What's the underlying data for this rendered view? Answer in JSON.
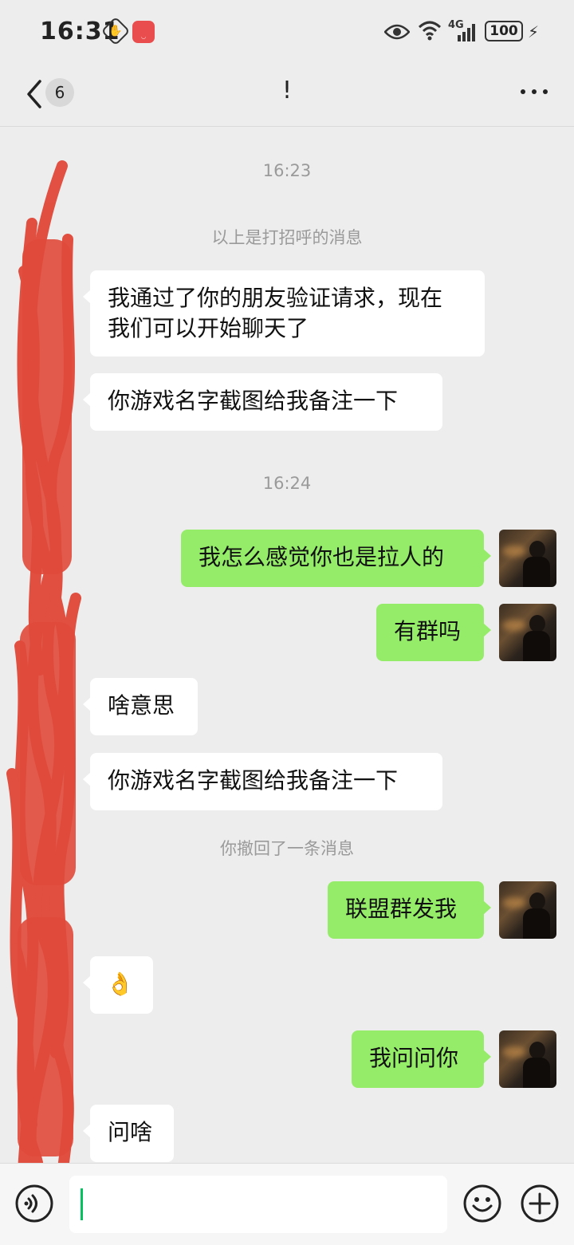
{
  "status_bar": {
    "time": "16:31",
    "network": "4G",
    "battery": "100",
    "icons": [
      "hand-icon",
      "huawei-app-icon",
      "eye-icon",
      "wifi-icon",
      "signal-icon",
      "battery-icon",
      "charging-bolt-icon"
    ]
  },
  "header": {
    "back_badge": "6",
    "title": "!",
    "more_icon": "more-icon"
  },
  "messages": [
    {
      "type": "system",
      "text": "16:23"
    },
    {
      "type": "system",
      "text": "以上是打招呼的消息"
    },
    {
      "type": "in",
      "lines": [
        "我通过了你的朋友验证请求，现在",
        "我们可以开始聊天了"
      ]
    },
    {
      "type": "in",
      "text": "你游戏名字截图给我备注一下"
    },
    {
      "type": "system",
      "text": "16:24"
    },
    {
      "type": "out",
      "text": "我怎么感觉你也是拉人的"
    },
    {
      "type": "out",
      "text": "有群吗"
    },
    {
      "type": "in",
      "text": "啥意思"
    },
    {
      "type": "in",
      "text": "你游戏名字截图给我备注一下"
    },
    {
      "type": "system",
      "text": "你撤回了一条消息"
    },
    {
      "type": "out",
      "text": "联盟群发我"
    },
    {
      "type": "in",
      "text": "👌"
    },
    {
      "type": "out",
      "text": "我问问你"
    },
    {
      "type": "in",
      "text": "问啥"
    }
  ],
  "input_bar": {
    "value": "",
    "icons": [
      "voice-icon",
      "emoji-icon",
      "plus-icon"
    ]
  },
  "colors": {
    "background": "#ededed",
    "outgoing_bubble": "#95ec69",
    "incoming_bubble": "#ffffff",
    "redaction_scribble": "#e0493a"
  }
}
